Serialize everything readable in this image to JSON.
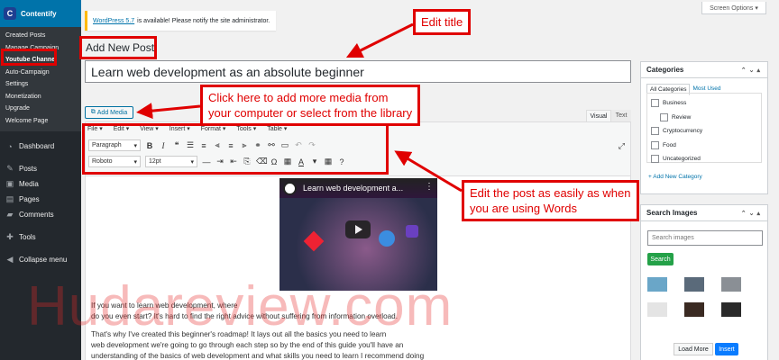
{
  "sidebar": {
    "brand": "Contentify",
    "submenu": [
      "Created Posts",
      "Manage Campaign",
      "Youtube Channel",
      "Auto-Campaign",
      "Settings",
      "Monetization",
      "Upgrade",
      "Welcome Page"
    ],
    "nav": [
      {
        "icon": "dashboard-icon",
        "label": "Dashboard"
      },
      {
        "icon": "posts-icon",
        "label": "Posts"
      },
      {
        "icon": "media-icon",
        "label": "Media"
      },
      {
        "icon": "pages-icon",
        "label": "Pages"
      },
      {
        "icon": "comments-icon",
        "label": "Comments"
      },
      {
        "icon": "tools-icon",
        "label": "Tools"
      },
      {
        "icon": "collapse-icon",
        "label": "Collapse menu"
      }
    ]
  },
  "top": {
    "screen_options": "Screen Options ▾",
    "notice_link": "WordPress 5.7",
    "notice_text": "is available! Please notify the site administrator."
  },
  "page_title": "Add New Post",
  "post_title": "Learn web development as an absolute beginner",
  "editor": {
    "add_media": "Add Media",
    "tab_visual": "Visual",
    "tab_text": "Text",
    "menu": [
      "File ▾",
      "Edit ▾",
      "View ▾",
      "Insert ▾",
      "Format ▾",
      "Tools ▾",
      "Table ▾"
    ],
    "paragraph_select": "Paragraph",
    "font_select": "Roboto",
    "size_select": "12pt",
    "video_title": "Learn web development a...",
    "body": [
      "If you want to learn web development, where",
      "do you even start? It's hard to find the right   advice without suffering from information overload.",
      "That's why I've created this beginner's roadmap!   It lays out all the basics you need to learn",
      "web development we're going to go through each   step so by the end of this guide you'll have an",
      "understanding of the basics of web development and   what skills you need to learn I recommend doing"
    ]
  },
  "categories": {
    "title": "Categories",
    "tab_all": "All Categories",
    "tab_used": "Most Used",
    "items": [
      {
        "label": "Business",
        "child": false
      },
      {
        "label": "Review",
        "child": true
      },
      {
        "label": "Cryptocurrency",
        "child": false
      },
      {
        "label": "Food",
        "child": false
      },
      {
        "label": "Uncategorized",
        "child": false
      }
    ],
    "add_link": "+ Add New Category"
  },
  "search_images": {
    "title": "Search Images",
    "placeholder": "Search images",
    "search_btn": "Search",
    "load_more": "Load More",
    "insert": "Insert"
  },
  "annotations": {
    "edit_title": "Edit title",
    "add_media": [
      "Click here to add more media from",
      "your computer or select from the library"
    ],
    "edit_post": [
      "Edit the post as easily as when",
      "you are using Words"
    ]
  },
  "watermark": "Hudareview.com"
}
